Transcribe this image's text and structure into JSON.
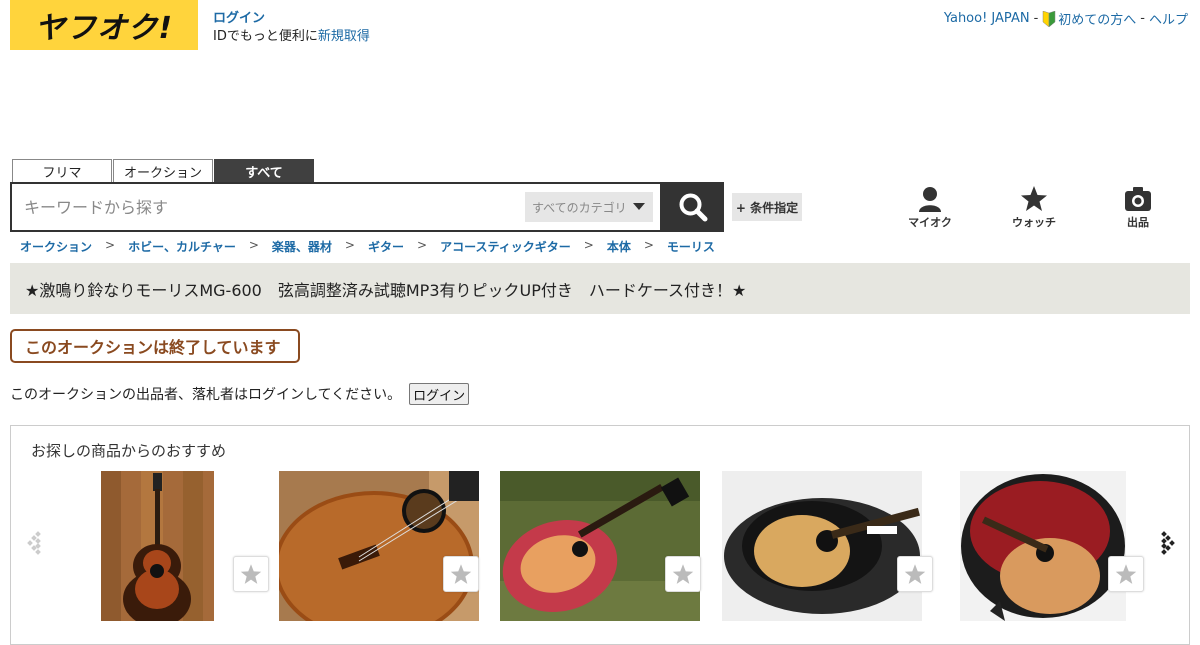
{
  "header": {
    "logo_text": "ヤフオク!",
    "login_label": "ログイン",
    "login_sub": "IDでもっと便利に",
    "signup_label": "新規取得",
    "links": {
      "yahoo_japan": "Yahoo! JAPAN",
      "sep1": "-",
      "beginners": "初めての方へ",
      "sep2": "-",
      "help": "ヘルプ"
    }
  },
  "search": {
    "tabs": [
      {
        "label": "フリマ",
        "active": false
      },
      {
        "label": "オークション",
        "active": false
      },
      {
        "label": "すべて",
        "active": true
      }
    ],
    "placeholder": "キーワードから探す",
    "category": "すべてのカテゴリ",
    "condition_label": "+ 条件指定"
  },
  "nav_icons": {
    "my_auction": "マイオク",
    "watch": "ウォッチ",
    "sell": "出品"
  },
  "breadcrumb": [
    "オークション",
    "ホビー、カルチャー",
    "楽器、器材",
    "ギター",
    "アコースティックギター",
    "本体",
    "モーリス"
  ],
  "breadcrumb_separator": ">",
  "item_title": "★激鳴り鈴なりモーリスMG-600　弦高調整済み試聴MP3有りピックUP付き　ハードケース付き！★",
  "ended_badge": "このオークションは終了しています",
  "login_message": "このオークションの出品者、落札者はログインしてください。",
  "login_button": "ログイン",
  "recommend": {
    "title": "お探しの商品からのおすすめ",
    "items": [
      {
        "name": "sunburst-guitar"
      },
      {
        "name": "classical-guitar"
      },
      {
        "name": "red-dove-guitar"
      },
      {
        "name": "natural-guitar-in-case"
      },
      {
        "name": "guitar-in-red-case"
      }
    ]
  },
  "colors": {
    "brand_yellow": "#ffd43c",
    "link_blue": "#1d6aa5",
    "dark": "#333333",
    "ended_brown": "#8a4a20",
    "title_bar_bg": "#e6e6e0"
  }
}
